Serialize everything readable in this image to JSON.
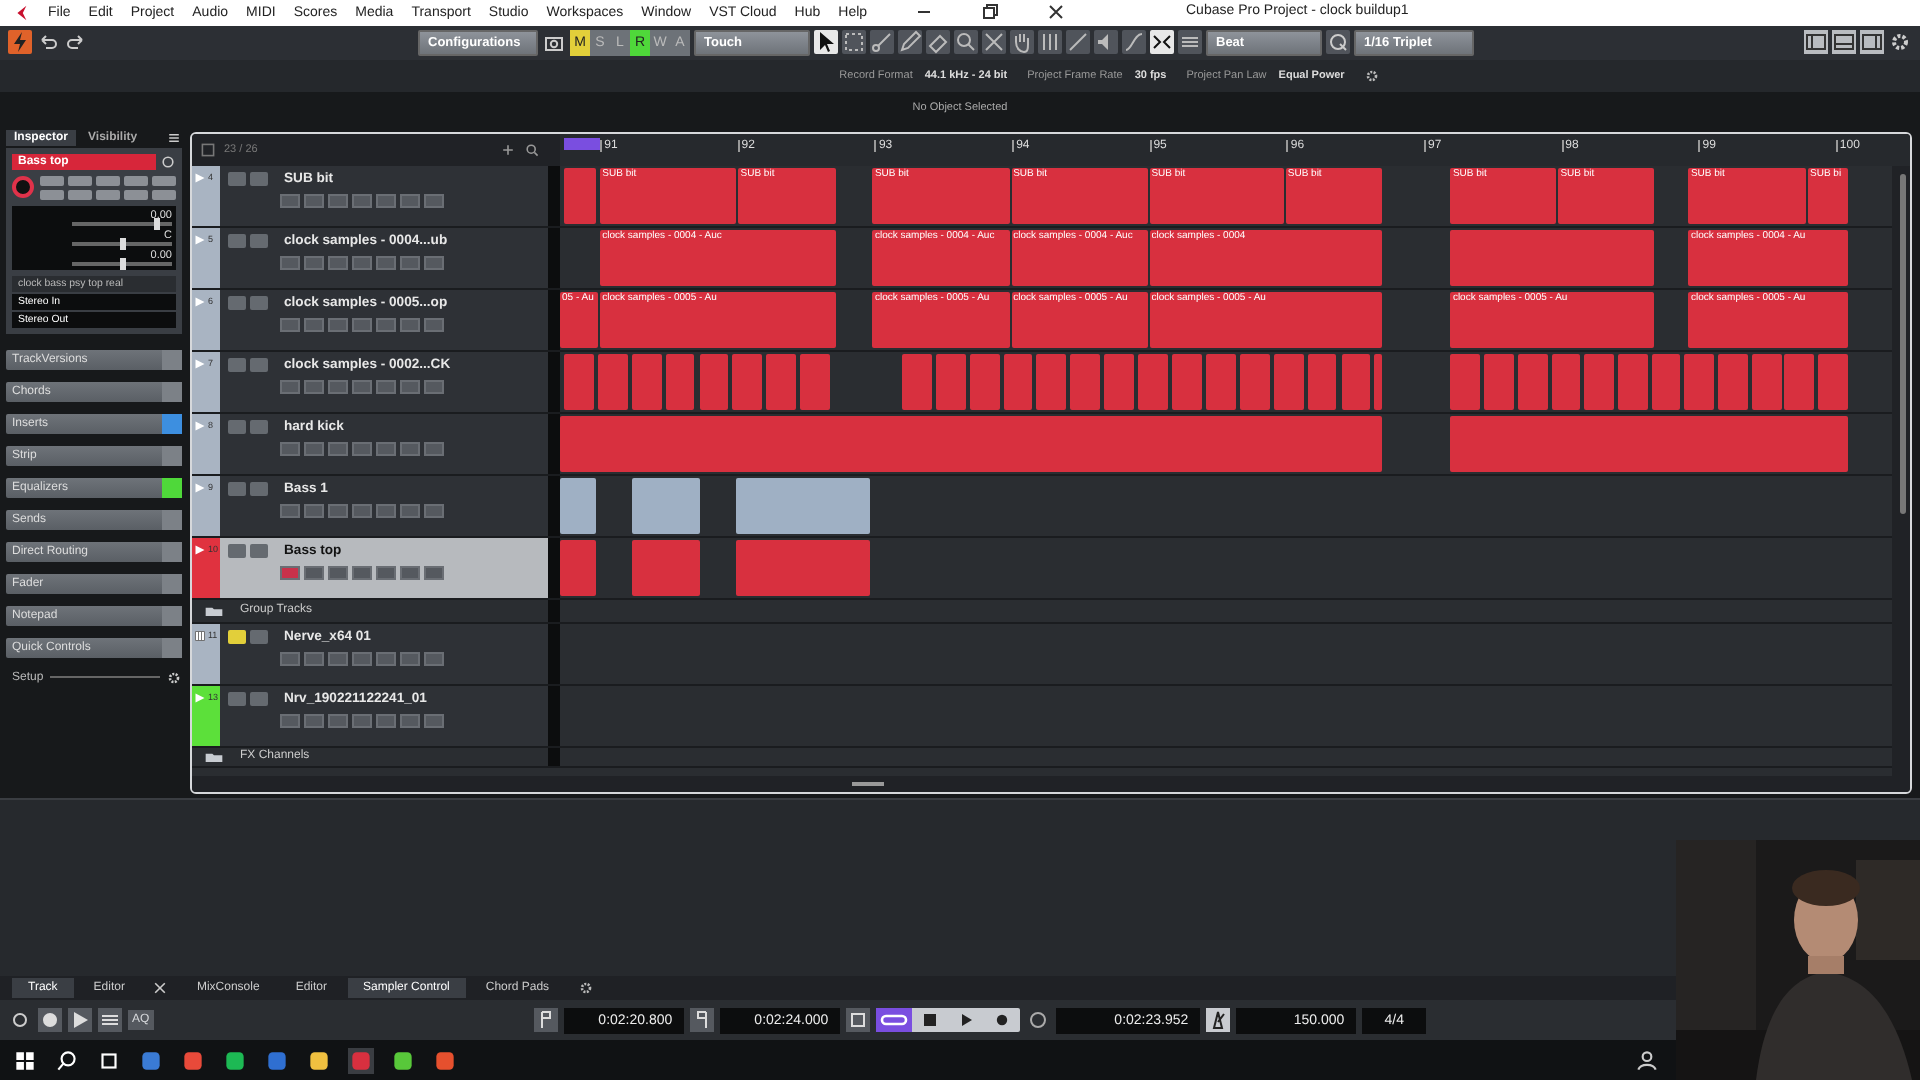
{
  "window": {
    "title": "Cubase Pro Project - clock buildup1"
  },
  "menu": [
    "File",
    "Edit",
    "Project",
    "Audio",
    "MIDI",
    "Scores",
    "Media",
    "Transport",
    "Studio",
    "Workspaces",
    "Window",
    "VST Cloud",
    "Hub",
    "Help"
  ],
  "toolbar": {
    "configurations": "Configurations",
    "automation": [
      {
        "label": "M",
        "on": true,
        "color": "#e2cf3a"
      },
      {
        "label": "S",
        "on": false
      },
      {
        "label": "L",
        "on": false
      },
      {
        "label": "R",
        "on": true,
        "color": "#4fd83a"
      },
      {
        "label": "W",
        "on": false
      },
      {
        "label": "A",
        "on": false
      }
    ],
    "automation_mode": "Touch",
    "grid_type": "Beat",
    "quantize": "1/16 Triplet"
  },
  "info_line": [
    {
      "label": "Record Format",
      "value": "44.1 kHz - 24 bit"
    },
    {
      "label": "Project Frame Rate",
      "value": "30 fps"
    },
    {
      "label": "Project Pan Law",
      "value": "Equal Power"
    }
  ],
  "event_info": "No Object Selected",
  "inspector": {
    "tabs": [
      {
        "label": "Inspector",
        "selected": true
      },
      {
        "label": "Visibility",
        "selected": false
      }
    ],
    "track_name": "Bass top",
    "record": true,
    "readouts": [
      {
        "value": "0.00",
        "level": 0.85
      },
      {
        "value": "C",
        "level": 0.5
      },
      {
        "value": "0.00",
        "level": 0.5
      }
    ],
    "routing": [
      "clock bass psy top real",
      "Stereo In",
      "Stereo Out"
    ],
    "sections": [
      {
        "label": "TrackVersions"
      },
      {
        "label": "Chords"
      },
      {
        "label": "Inserts",
        "color": "#3d8fe0"
      },
      {
        "label": "Strip"
      },
      {
        "label": "Equalizers",
        "color": "#4fd83a"
      },
      {
        "label": "Sends"
      },
      {
        "label": "Direct Routing"
      },
      {
        "label": "Fader"
      },
      {
        "label": "Notepad"
      },
      {
        "label": "Quick Controls"
      }
    ],
    "setup": "Setup"
  },
  "project": {
    "counter": "23 / 26",
    "ruler": [
      "91",
      "92",
      "93",
      "94",
      "95",
      "96",
      "97",
      "98",
      "99",
      "100"
    ],
    "tracks": [
      {
        "kind": "audio",
        "number": "4",
        "name": "SUB bit",
        "color": "#a9b4c2",
        "selected": false,
        "muted": false,
        "record": false,
        "events": [
          {
            "label": "SUB bit"
          },
          {
            "label": "SUB bit"
          },
          {
            "label": "SUB bit"
          },
          {
            "label": "SUB bit"
          },
          {
            "label": "SUB bit"
          },
          {
            "label": "SUB bit"
          },
          {
            "label": "SUB bit"
          },
          {
            "label": "SUB bit"
          },
          {
            "label": "SUB bit"
          },
          {
            "label": "SUB bi"
          }
        ]
      },
      {
        "kind": "audio",
        "number": "5",
        "name": "clock samples - 0004...ub",
        "color": "#a9b4c2",
        "selected": false,
        "muted": false,
        "record": false,
        "events": [
          {
            "label": "clock samples - 0004 - Auc"
          },
          {
            "label": "clock samples - 0004 - Auc"
          },
          {
            "label": "clock samples - 0004 - Auc"
          },
          {
            "label": "clock samples - 0004"
          },
          {
            "label": "clock samples - 0004 - Au"
          }
        ]
      },
      {
        "kind": "audio",
        "number": "6",
        "name": "clock samples - 0005...op",
        "color": "#a9b4c2",
        "selected": false,
        "muted": false,
        "record": false,
        "events": [
          {
            "label": "05 - Au"
          },
          {
            "label": "clock samples - 0005 - Au"
          },
          {
            "label": "clock samples - 0005 - Au"
          },
          {
            "label": "clock samples - 0005 - Au"
          },
          {
            "label": "clock samples - 0005 - Au"
          },
          {
            "label": "clock samples - 0005 - Au"
          },
          {
            "label": "clock samples - 0005 - Au"
          }
        ]
      },
      {
        "kind": "audio",
        "number": "7",
        "name": "clock samples - 0002...CK",
        "color": "#a9b4c2",
        "selected": false,
        "muted": false,
        "record": false
      },
      {
        "kind": "audio",
        "number": "8",
        "name": "hard kick",
        "color": "#a9b4c2",
        "selected": false,
        "muted": false,
        "record": false
      },
      {
        "kind": "audio",
        "number": "9",
        "name": "Bass 1",
        "color": "#a9b4c2",
        "selected": false,
        "muted": false,
        "record": false
      },
      {
        "kind": "audio",
        "number": "10",
        "name": "Bass top",
        "color": "#e0323f",
        "selected": true,
        "muted": false,
        "record": true
      },
      {
        "kind": "folder",
        "name": "Group Tracks"
      },
      {
        "kind": "instrument",
        "number": "11",
        "name": "Nerve_x64 01",
        "color": "#a9b4c2",
        "selected": false,
        "muted": true,
        "record": false
      },
      {
        "kind": "audio",
        "number": "13",
        "name": "Nrv_190221122241_01",
        "color": "#5ce03a",
        "selected": false,
        "muted": false,
        "record": false
      },
      {
        "kind": "folder",
        "name": "FX Channels"
      }
    ]
  },
  "lower_zone": {
    "left_tabs": [
      {
        "label": "Track",
        "selected": true
      },
      {
        "label": "Editor",
        "selected": false
      }
    ],
    "tabs": [
      {
        "label": "MixConsole",
        "selected": false
      },
      {
        "label": "Editor",
        "selected": false
      },
      {
        "label": "Sampler Control",
        "selected": true
      },
      {
        "label": "Chord Pads",
        "selected": false
      }
    ]
  },
  "transport": {
    "left_locator": "0:02:20.800",
    "right_locator": "0:02:24.000",
    "cycle": true,
    "position": "0:02:23.952",
    "tempo": "150.000",
    "signature": "4/4",
    "auto_quantize": "AQ"
  }
}
